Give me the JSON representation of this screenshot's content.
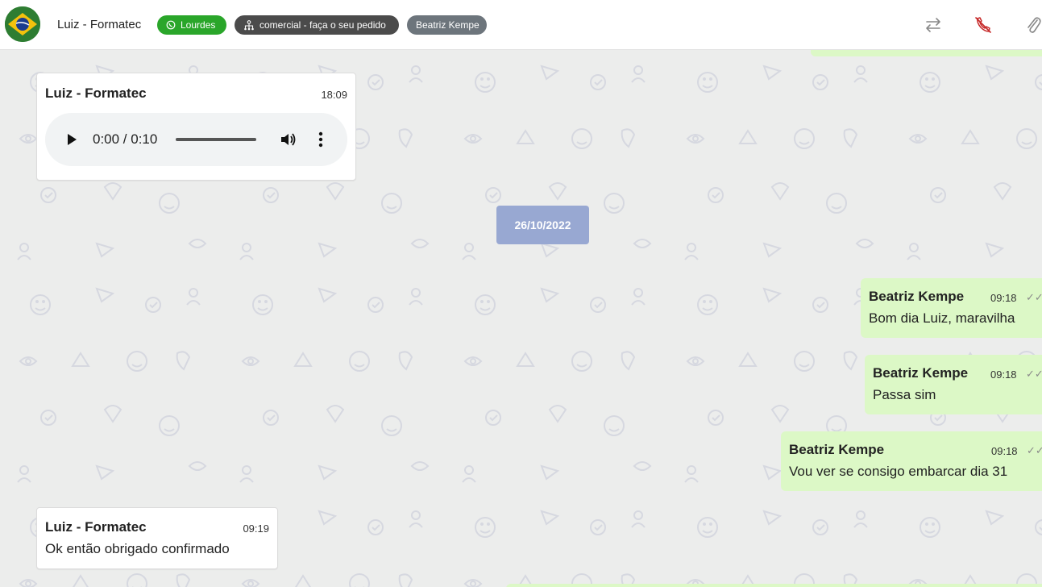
{
  "header": {
    "contact_name": "Luiz - Formatec",
    "chips": [
      {
        "label": "Lourdes",
        "icon": "whatsapp-icon"
      },
      {
        "label": "comercial - faça o seu pedido",
        "icon": "hierarchy-icon"
      },
      {
        "label": "Beatriz Kempe"
      }
    ],
    "actions": [
      "transfer-icon",
      "end-call-icon",
      "attach-icon"
    ]
  },
  "date_divider": "26/10/2022",
  "messages": [
    {
      "sender": "Luiz - Formatec",
      "time": "18:09",
      "type": "audio",
      "audio_time": "0:00 / 0:10"
    },
    {
      "sender": "Beatriz Kempe",
      "time": "09:18",
      "text": "Bom dia Luiz, maravilha"
    },
    {
      "sender": "Beatriz Kempe",
      "time": "09:18",
      "text": "Passa sim"
    },
    {
      "sender": "Beatriz Kempe",
      "time": "09:18",
      "text": "Vou ver se consigo embarcar dia 31"
    },
    {
      "sender": "Luiz - Formatec",
      "time": "09:19",
      "text": "Ok então obrigado confirmado"
    }
  ],
  "colors": {
    "outgoing_bubble": "#dcf8c6",
    "date_chip": "#98a8d2",
    "whatsapp_chip": "#2aa62a",
    "end_call_icon": "#c62828"
  }
}
